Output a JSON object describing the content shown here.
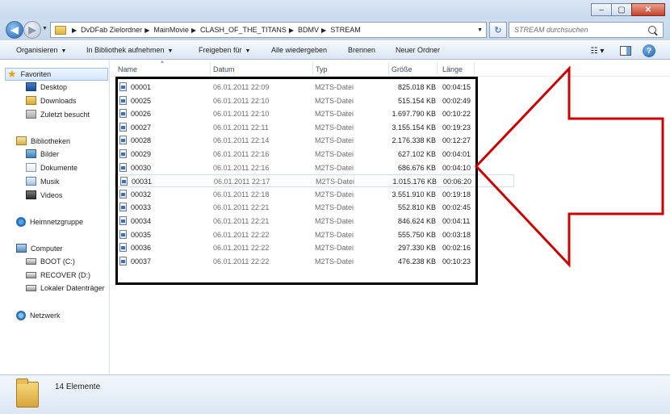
{
  "window": {
    "minimize_glyph": "–",
    "maximize_glyph": "▢",
    "close_glyph": "✕"
  },
  "address_bar": {
    "crumbs": [
      "DvDFab Zielordner",
      "MainMovie",
      "CLASH_OF_THE_TITANS",
      "BDMV",
      "STREAM"
    ]
  },
  "search": {
    "placeholder": "STREAM durchsuchen"
  },
  "toolbar": {
    "organize": "Organisieren",
    "include_library": "In Bibliothek aufnehmen",
    "share": "Freigeben für",
    "play_all": "Alle wiedergeben",
    "burn": "Brennen",
    "new_folder": "Neuer Ordner"
  },
  "sidebar": {
    "favorites": "Favoriten",
    "desktop": "Desktop",
    "downloads": "Downloads",
    "recent": "Zuletzt besucht",
    "libraries": "Bibliotheken",
    "pictures": "Bilder",
    "documents": "Dokumente",
    "music": "Musik",
    "videos": "Videos",
    "homegroup": "Heimnetzgruppe",
    "computer": "Computer",
    "drive_c": "BOOT (C:)",
    "drive_d": "RECOVER (D:)",
    "local_drive": "Lokaler Datenträger",
    "network": "Netzwerk"
  },
  "columns": {
    "name": "Name",
    "date": "Datum",
    "type": "Typ",
    "size": "Größe",
    "length": "Länge"
  },
  "files": [
    {
      "name": "00001",
      "date": "06.01.2011 22:09",
      "type": "M2TS-Datei",
      "size": "825.018 KB",
      "length": "00:04:15"
    },
    {
      "name": "00025",
      "date": "06.01.2011 22:10",
      "type": "M2TS-Datei",
      "size": "515.154 KB",
      "length": "00:02:49"
    },
    {
      "name": "00026",
      "date": "06.01.2011 22:10",
      "type": "M2TS-Datei",
      "size": "1.697.790 KB",
      "length": "00:10:22"
    },
    {
      "name": "00027",
      "date": "06.01.2011 22:11",
      "type": "M2TS-Datei",
      "size": "3.155.154 KB",
      "length": "00:19:23"
    },
    {
      "name": "00028",
      "date": "06.01.2011 22:14",
      "type": "M2TS-Datei",
      "size": "2.176.338 KB",
      "length": "00:12:27"
    },
    {
      "name": "00029",
      "date": "06.01.2011 22:16",
      "type": "M2TS-Datei",
      "size": "627.102 KB",
      "length": "00:04:01"
    },
    {
      "name": "00030",
      "date": "06.01.2011 22:16",
      "type": "M2TS-Datei",
      "size": "686.676 KB",
      "length": "00:04:10"
    },
    {
      "name": "00031",
      "date": "06.01.2011 22:17",
      "type": "M2TS-Datei",
      "size": "1.015.176 KB",
      "length": "00:06:20"
    },
    {
      "name": "00032",
      "date": "06.01.2011 22:18",
      "type": "M2TS-Datei",
      "size": "3.551.910 KB",
      "length": "00:19:18"
    },
    {
      "name": "00033",
      "date": "06.01.2011 22:21",
      "type": "M2TS-Datei",
      "size": "552.810 KB",
      "length": "00:02:45"
    },
    {
      "name": "00034",
      "date": "06.01.2011 22:21",
      "type": "M2TS-Datei",
      "size": "846.624 KB",
      "length": "00:04:11"
    },
    {
      "name": "00035",
      "date": "06.01.2011 22:22",
      "type": "M2TS-Datei",
      "size": "555.750 KB",
      "length": "00:03:18"
    },
    {
      "name": "00036",
      "date": "06.01.2011 22:22",
      "type": "M2TS-Datei",
      "size": "297.330 KB",
      "length": "00:02:16"
    },
    {
      "name": "00037",
      "date": "06.01.2011 22:22",
      "type": "M2TS-Datei",
      "size": "476.238 KB",
      "length": "00:10:23"
    }
  ],
  "selected_file": "00031",
  "status": {
    "count_text": "14 Elemente"
  },
  "colors": {
    "annotation_arrow": "#cc0000",
    "annotation_box": "#000000"
  }
}
